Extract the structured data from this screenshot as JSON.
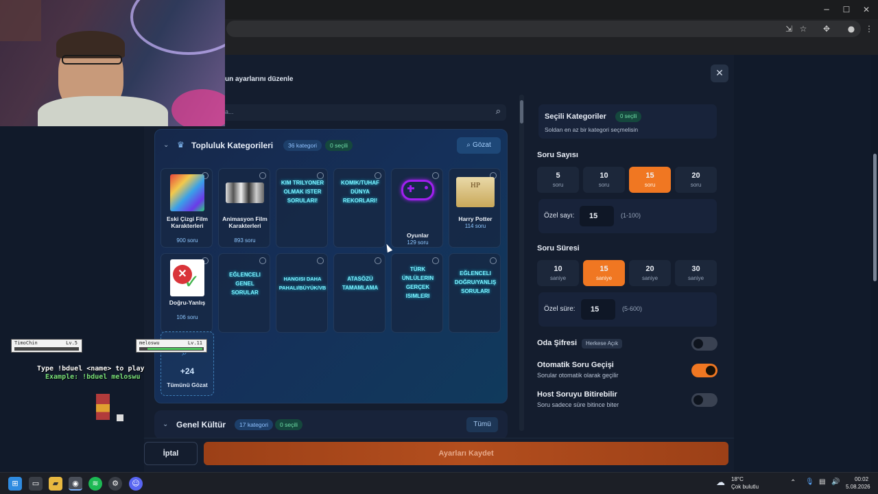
{
  "window": {
    "minimize": "─",
    "maximize": "☐",
    "close": "✕"
  },
  "modal": {
    "subtitle": "un ayarlarını düzenle",
    "search_placeholder": "a...",
    "close_glyph": "✕"
  },
  "community": {
    "title": "Topluluk Kategorileri",
    "category_count": "36 kategori",
    "selected_count": "0 seçili",
    "browse_label": "Gözat",
    "cards": [
      {
        "name": "Eski Çizgi Film Karakterleri",
        "count": "900 soru"
      },
      {
        "name": "Animasyon Film Karakterleri",
        "count": "893 soru"
      },
      {
        "neon": "KIM TRILYONER OLMAK ISTER SORULARI!"
      },
      {
        "neon": "KOMIK/TUHAF DÜNYA REKORLARI!"
      },
      {
        "name": "Oyunlar",
        "count": "129 soru"
      },
      {
        "name": "Harry Potter",
        "count": "114 soru"
      },
      {
        "name": "Doğru-Yanlış",
        "count": "106 soru"
      },
      {
        "neon": "EĞLENCELI GENEL SORULAR"
      },
      {
        "neon": "HANGISI DAHA PAHALI/BÜYÜK/VB"
      },
      {
        "neon": "ATASÖZÜ TAMAMLAMA"
      },
      {
        "neon": "TÜRK ÜNLÜLERIN GERÇEK ISIMLERI"
      },
      {
        "neon": "EĞLENCELI DOĞRU/YANLIŞ SORULARI"
      }
    ],
    "more_count": "+24",
    "more_label": "Tümünü Gözat"
  },
  "genel": {
    "title": "Genel Kültür",
    "category_count": "17 kategori",
    "selected_count": "0 seçili",
    "all_label": "Tümü"
  },
  "settings": {
    "selected_title": "Seçili Kategoriler",
    "selected_badge": "0 seçili",
    "selected_hint": "Soldan en az bir kategori seçmelisin",
    "question_count_label": "Soru Sayısı",
    "question_counts": [
      {
        "n": "5",
        "u": "soru"
      },
      {
        "n": "10",
        "u": "soru"
      },
      {
        "n": "15",
        "u": "soru"
      },
      {
        "n": "20",
        "u": "soru"
      }
    ],
    "question_count_active": "15",
    "custom_count_label": "Özel sayı:",
    "custom_count_value": "15",
    "custom_count_range": "(1-100)",
    "duration_label": "Soru Süresi",
    "durations": [
      {
        "n": "10",
        "u": "saniye"
      },
      {
        "n": "15",
        "u": "saniye"
      },
      {
        "n": "20",
        "u": "saniye"
      },
      {
        "n": "30",
        "u": "saniye"
      }
    ],
    "duration_active": "15",
    "custom_duration_label": "Özel süre:",
    "custom_duration_value": "15",
    "custom_duration_range": "(5-600)",
    "room_password_label": "Oda Şifresi",
    "room_password_badge": "Herkese Açık",
    "room_password_on": false,
    "auto_next_label": "Otomatik Soru Geçişi",
    "auto_next_desc": "Sorular otomatik olarak geçilir",
    "auto_next_on": true,
    "host_end_label": "Host Soruyu Bitirebilir",
    "host_end_desc": "Soru sadece süre bitince biter",
    "host_end_on": false
  },
  "footer": {
    "cancel_label": "İptal",
    "save_label": "Ayarları Kaydet"
  },
  "overlay": {
    "player1": "TimoChin",
    "player1_level": "Lv.5",
    "player2": "meloswu",
    "player2_level": "Lv.11",
    "line1": "Type !bduel <name> to play",
    "line2": "Example: !bduel meloswu"
  },
  "taskbar": {
    "temperature": "18°C",
    "weather": "Çok bulutlu",
    "time": "00:02",
    "date": "5.08.2026"
  },
  "colors": {
    "accent": "#f07722",
    "neon": "#7cf2ff",
    "badge_green": "#6fe0a8",
    "badge_blue": "#8fc2ff"
  }
}
